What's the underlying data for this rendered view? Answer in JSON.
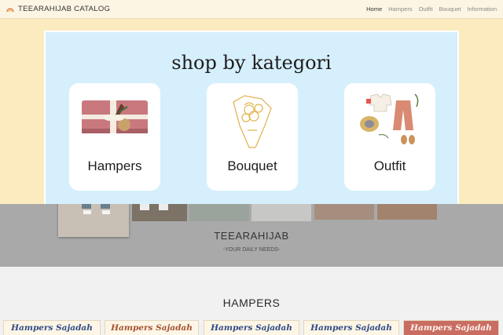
{
  "nav": {
    "brand": "TEEARAHIJAB CATALOG",
    "links": [
      "Home",
      "Hampers",
      "Outfit",
      "Bouquet",
      "Information"
    ]
  },
  "category": {
    "title": "shop by kategori",
    "cards": [
      {
        "label": "Hampers",
        "icon": "gift-box-icon"
      },
      {
        "label": "Bouquet",
        "icon": "flower-bouquet-icon"
      },
      {
        "label": "Outfit",
        "icon": "clothing-set-icon"
      }
    ]
  },
  "banner": {
    "name": "TEEARAHIJAB",
    "tagline": "-YOUR DAILY NEEDS-"
  },
  "hampers": {
    "title": "HAMPERS",
    "items": [
      "Hampers Sajadah",
      "Hampers Sajadah",
      "Hampers Sajadah",
      "Hampers Sajadah",
      "Hampers Sajadah"
    ]
  },
  "colors": {
    "navbar": "#fcf5e4",
    "hero": "#fbebbf",
    "panel": "#d6effc",
    "overlay": "#a9a9a9",
    "hampers_text": "#2f4a87"
  }
}
